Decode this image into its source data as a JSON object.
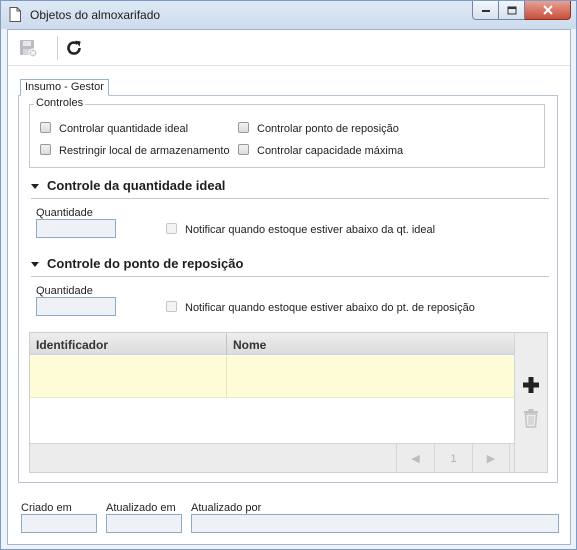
{
  "window": {
    "title": "Objetos do almoxarifado",
    "icon": "document-icon"
  },
  "toolbar": {
    "save_icon": "save-disabled-icon",
    "refresh_icon": "refresh-icon"
  },
  "tabs": [
    {
      "label": "Insumo - Gestor",
      "active": true
    }
  ],
  "controles": {
    "legend": "Controles",
    "items": [
      {
        "label": "Controlar quantidade ideal",
        "checked": false
      },
      {
        "label": "Controlar ponto de reposição",
        "checked": false
      },
      {
        "label": "Restringir local de armazenamento",
        "checked": false
      },
      {
        "label": "Controlar capacidade máxima",
        "checked": false
      }
    ]
  },
  "quantidade_ideal": {
    "title": "Controle da quantidade ideal",
    "field_label": "Quantidade",
    "value": "",
    "notify_label": "Notificar quando estoque estiver abaixo da qt. ideal",
    "notify_checked": false
  },
  "ponto_reposicao": {
    "title": "Controle do ponto de reposição",
    "field_label": "Quantidade",
    "value": "",
    "notify_label": "Notificar quando estoque estiver abaixo do pt. de reposição",
    "notify_checked": false
  },
  "grid": {
    "columns": [
      "Identificador",
      "Nome"
    ],
    "rows": [
      [
        "",
        ""
      ]
    ],
    "page": "1",
    "prev_label": "◀",
    "next_label": "▶",
    "add_icon": "plus-icon",
    "delete_icon": "trash-icon"
  },
  "footer": {
    "criado_em_label": "Criado em",
    "criado_em_value": "",
    "atualizado_em_label": "Atualizado em",
    "atualizado_em_value": "",
    "atualizado_por_label": "Atualizado por",
    "atualizado_por_value": ""
  },
  "colors": {
    "selected_row": "#fdfcd7",
    "add_icon": "#222222",
    "input_border": "#8fa9c9"
  }
}
